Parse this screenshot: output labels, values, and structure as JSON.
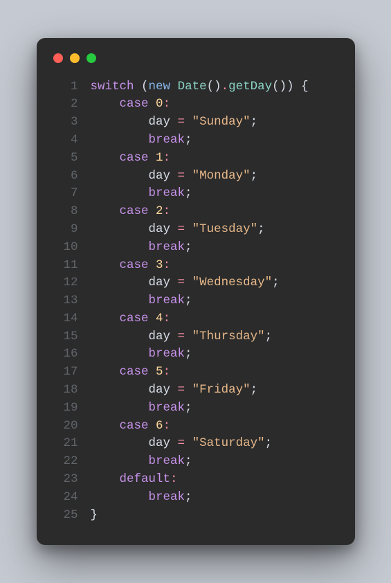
{
  "window": {
    "traffic_lights": [
      "red",
      "yellow",
      "green"
    ]
  },
  "code": {
    "lines": [
      {
        "n": "1",
        "tokens": [
          {
            "c": "tok-kw",
            "t": "switch"
          },
          {
            "c": "tok-plain",
            "t": " "
          },
          {
            "c": "tok-punc",
            "t": "("
          },
          {
            "c": "tok-kw2",
            "t": "new"
          },
          {
            "c": "tok-plain",
            "t": " "
          },
          {
            "c": "tok-fn",
            "t": "Date"
          },
          {
            "c": "tok-punc",
            "t": "()"
          },
          {
            "c": "tok-op",
            "t": "."
          },
          {
            "c": "tok-fn",
            "t": "getDay"
          },
          {
            "c": "tok-punc",
            "t": "())"
          },
          {
            "c": "tok-plain",
            "t": " "
          },
          {
            "c": "tok-punc",
            "t": "{"
          }
        ]
      },
      {
        "n": "2",
        "tokens": [
          {
            "c": "tok-plain",
            "t": "    "
          },
          {
            "c": "tok-kw",
            "t": "case"
          },
          {
            "c": "tok-plain",
            "t": " "
          },
          {
            "c": "tok-num",
            "t": "0"
          },
          {
            "c": "tok-op",
            "t": ":"
          }
        ]
      },
      {
        "n": "3",
        "tokens": [
          {
            "c": "tok-plain",
            "t": "        "
          },
          {
            "c": "tok-ident",
            "t": "day"
          },
          {
            "c": "tok-plain",
            "t": " "
          },
          {
            "c": "tok-op",
            "t": "="
          },
          {
            "c": "tok-plain",
            "t": " "
          },
          {
            "c": "tok-str",
            "t": "\"Sunday\""
          },
          {
            "c": "tok-punc",
            "t": ";"
          }
        ]
      },
      {
        "n": "4",
        "tokens": [
          {
            "c": "tok-plain",
            "t": "        "
          },
          {
            "c": "tok-kw",
            "t": "break"
          },
          {
            "c": "tok-punc",
            "t": ";"
          }
        ]
      },
      {
        "n": "5",
        "tokens": [
          {
            "c": "tok-plain",
            "t": "    "
          },
          {
            "c": "tok-kw",
            "t": "case"
          },
          {
            "c": "tok-plain",
            "t": " "
          },
          {
            "c": "tok-num",
            "t": "1"
          },
          {
            "c": "tok-op",
            "t": ":"
          }
        ]
      },
      {
        "n": "6",
        "tokens": [
          {
            "c": "tok-plain",
            "t": "        "
          },
          {
            "c": "tok-ident",
            "t": "day"
          },
          {
            "c": "tok-plain",
            "t": " "
          },
          {
            "c": "tok-op",
            "t": "="
          },
          {
            "c": "tok-plain",
            "t": " "
          },
          {
            "c": "tok-str",
            "t": "\"Monday\""
          },
          {
            "c": "tok-punc",
            "t": ";"
          }
        ]
      },
      {
        "n": "7",
        "tokens": [
          {
            "c": "tok-plain",
            "t": "        "
          },
          {
            "c": "tok-kw",
            "t": "break"
          },
          {
            "c": "tok-punc",
            "t": ";"
          }
        ]
      },
      {
        "n": "8",
        "tokens": [
          {
            "c": "tok-plain",
            "t": "    "
          },
          {
            "c": "tok-kw",
            "t": "case"
          },
          {
            "c": "tok-plain",
            "t": " "
          },
          {
            "c": "tok-num",
            "t": "2"
          },
          {
            "c": "tok-op",
            "t": ":"
          }
        ]
      },
      {
        "n": "9",
        "tokens": [
          {
            "c": "tok-plain",
            "t": "        "
          },
          {
            "c": "tok-ident",
            "t": "day"
          },
          {
            "c": "tok-plain",
            "t": " "
          },
          {
            "c": "tok-op",
            "t": "="
          },
          {
            "c": "tok-plain",
            "t": " "
          },
          {
            "c": "tok-str",
            "t": "\"Tuesday\""
          },
          {
            "c": "tok-punc",
            "t": ";"
          }
        ]
      },
      {
        "n": "10",
        "tokens": [
          {
            "c": "tok-plain",
            "t": "        "
          },
          {
            "c": "tok-kw",
            "t": "break"
          },
          {
            "c": "tok-punc",
            "t": ";"
          }
        ]
      },
      {
        "n": "11",
        "tokens": [
          {
            "c": "tok-plain",
            "t": "    "
          },
          {
            "c": "tok-kw",
            "t": "case"
          },
          {
            "c": "tok-plain",
            "t": " "
          },
          {
            "c": "tok-num",
            "t": "3"
          },
          {
            "c": "tok-op",
            "t": ":"
          }
        ]
      },
      {
        "n": "12",
        "tokens": [
          {
            "c": "tok-plain",
            "t": "        "
          },
          {
            "c": "tok-ident",
            "t": "day"
          },
          {
            "c": "tok-plain",
            "t": " "
          },
          {
            "c": "tok-op",
            "t": "="
          },
          {
            "c": "tok-plain",
            "t": " "
          },
          {
            "c": "tok-str",
            "t": "\"Wednesday\""
          },
          {
            "c": "tok-punc",
            "t": ";"
          }
        ]
      },
      {
        "n": "13",
        "tokens": [
          {
            "c": "tok-plain",
            "t": "        "
          },
          {
            "c": "tok-kw",
            "t": "break"
          },
          {
            "c": "tok-punc",
            "t": ";"
          }
        ]
      },
      {
        "n": "14",
        "tokens": [
          {
            "c": "tok-plain",
            "t": "    "
          },
          {
            "c": "tok-kw",
            "t": "case"
          },
          {
            "c": "tok-plain",
            "t": " "
          },
          {
            "c": "tok-num",
            "t": "4"
          },
          {
            "c": "tok-op",
            "t": ":"
          }
        ]
      },
      {
        "n": "15",
        "tokens": [
          {
            "c": "tok-plain",
            "t": "        "
          },
          {
            "c": "tok-ident",
            "t": "day"
          },
          {
            "c": "tok-plain",
            "t": " "
          },
          {
            "c": "tok-op",
            "t": "="
          },
          {
            "c": "tok-plain",
            "t": " "
          },
          {
            "c": "tok-str",
            "t": "\"Thursday\""
          },
          {
            "c": "tok-punc",
            "t": ";"
          }
        ]
      },
      {
        "n": "16",
        "tokens": [
          {
            "c": "tok-plain",
            "t": "        "
          },
          {
            "c": "tok-kw",
            "t": "break"
          },
          {
            "c": "tok-punc",
            "t": ";"
          }
        ]
      },
      {
        "n": "17",
        "tokens": [
          {
            "c": "tok-plain",
            "t": "    "
          },
          {
            "c": "tok-kw",
            "t": "case"
          },
          {
            "c": "tok-plain",
            "t": " "
          },
          {
            "c": "tok-num",
            "t": "5"
          },
          {
            "c": "tok-op",
            "t": ":"
          }
        ]
      },
      {
        "n": "18",
        "tokens": [
          {
            "c": "tok-plain",
            "t": "        "
          },
          {
            "c": "tok-ident",
            "t": "day"
          },
          {
            "c": "tok-plain",
            "t": " "
          },
          {
            "c": "tok-op",
            "t": "="
          },
          {
            "c": "tok-plain",
            "t": " "
          },
          {
            "c": "tok-str",
            "t": "\"Friday\""
          },
          {
            "c": "tok-punc",
            "t": ";"
          }
        ]
      },
      {
        "n": "19",
        "tokens": [
          {
            "c": "tok-plain",
            "t": "        "
          },
          {
            "c": "tok-kw",
            "t": "break"
          },
          {
            "c": "tok-punc",
            "t": ";"
          }
        ]
      },
      {
        "n": "20",
        "tokens": [
          {
            "c": "tok-plain",
            "t": "    "
          },
          {
            "c": "tok-kw",
            "t": "case"
          },
          {
            "c": "tok-plain",
            "t": " "
          },
          {
            "c": "tok-num",
            "t": "6"
          },
          {
            "c": "tok-op",
            "t": ":"
          }
        ]
      },
      {
        "n": "21",
        "tokens": [
          {
            "c": "tok-plain",
            "t": "        "
          },
          {
            "c": "tok-ident",
            "t": "day"
          },
          {
            "c": "tok-plain",
            "t": " "
          },
          {
            "c": "tok-op",
            "t": "="
          },
          {
            "c": "tok-plain",
            "t": " "
          },
          {
            "c": "tok-str",
            "t": "\"Saturday\""
          },
          {
            "c": "tok-punc",
            "t": ";"
          }
        ]
      },
      {
        "n": "22",
        "tokens": [
          {
            "c": "tok-plain",
            "t": "        "
          },
          {
            "c": "tok-kw",
            "t": "break"
          },
          {
            "c": "tok-punc",
            "t": ";"
          }
        ]
      },
      {
        "n": "23",
        "tokens": [
          {
            "c": "tok-plain",
            "t": "    "
          },
          {
            "c": "tok-kw",
            "t": "default"
          },
          {
            "c": "tok-op",
            "t": ":"
          }
        ]
      },
      {
        "n": "24",
        "tokens": [
          {
            "c": "tok-plain",
            "t": "        "
          },
          {
            "c": "tok-kw",
            "t": "break"
          },
          {
            "c": "tok-punc",
            "t": ";"
          }
        ]
      },
      {
        "n": "25",
        "tokens": [
          {
            "c": "tok-punc",
            "t": "}"
          }
        ]
      }
    ]
  }
}
